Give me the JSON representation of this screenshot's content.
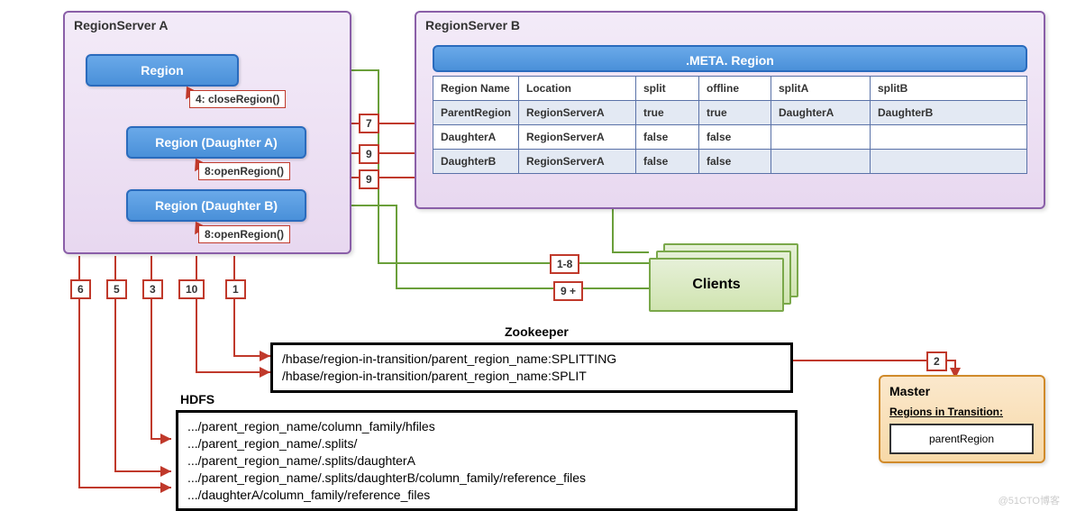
{
  "rsA": {
    "title": "RegionServer A",
    "region": "Region",
    "daughterA": "Region (Daughter A)",
    "daughterB": "Region (Daughter B)",
    "calloutClose": "4: closeRegion()",
    "calloutOpenA": "8:openRegion()",
    "calloutOpenB": "8:openRegion()"
  },
  "rsB": {
    "title": "RegionServer B",
    "metaTitle": ".META. Region",
    "headers": [
      "Region Name",
      "Location",
      "split",
      "offline",
      "splitA",
      "splitB"
    ],
    "rows": [
      [
        "ParentRegion",
        "RegionServerA",
        "true",
        "true",
        "DaughterA",
        "DaughterB"
      ],
      [
        "DaughterA",
        "RegionServerA",
        "false",
        "false",
        "",
        ""
      ],
      [
        "DaughterB",
        "RegionServerA",
        "false",
        "false",
        "",
        ""
      ]
    ]
  },
  "steps": {
    "s1": "1",
    "s2": "2",
    "s3": "3",
    "s5": "5",
    "s6": "6",
    "s7": "7",
    "s9a": "9",
    "s9b": "9",
    "s10": "10",
    "s1_8": "1-8",
    "s9plus": "9 +"
  },
  "clients": {
    "label": "Clients"
  },
  "zk": {
    "title": "Zookeeper",
    "line1": "/hbase/region-in-transition/parent_region_name:SPLITTING",
    "line2": "/hbase/region-in-transition/parent_region_name:SPLIT"
  },
  "hdfs": {
    "title": "HDFS",
    "lines": [
      ".../parent_region_name/column_family/hfiles",
      ".../parent_region_name/.splits/",
      ".../parent_region_name/.splits/daughterA",
      ".../parent_region_name/.splits/daughterB/column_family/reference_files",
      ".../daughterA/column_family/reference_files"
    ]
  },
  "master": {
    "title": "Master",
    "ritLabel": "Regions in Transition:",
    "ritValue": "parentRegion"
  },
  "watermark": "@51CTO博客"
}
